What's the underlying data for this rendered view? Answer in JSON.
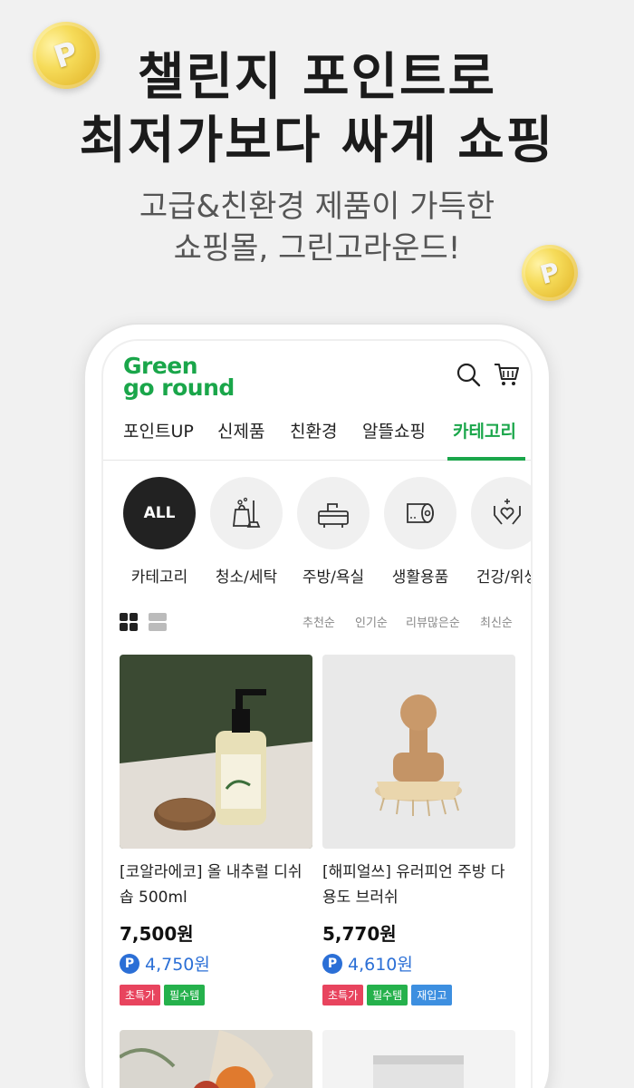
{
  "promo": {
    "headline_1": "챌린지 포인트로",
    "headline_2": "최저가보다 싸게 쇼핑",
    "subline_1": "고급&친환경 제품이 가득한",
    "subline_2": "쇼핑몰, 그린고라운드!",
    "coin_symbol": "P"
  },
  "app": {
    "logo_line_1": "Green",
    "logo_line_2": "go round",
    "brand_color": "#1aa64a",
    "tabs": [
      {
        "label": "포인트UP"
      },
      {
        "label": "신제품"
      },
      {
        "label": "친환경"
      },
      {
        "label": "알뜰쇼핑"
      },
      {
        "label": "카테고리",
        "active": true
      }
    ],
    "categories": [
      {
        "label": "카테고리",
        "circle": "ALL",
        "icon": "all-icon"
      },
      {
        "label": "청소/세탁",
        "icon": "cleaning-icon"
      },
      {
        "label": "주방/욕실",
        "icon": "kitchen-sink-icon"
      },
      {
        "label": "생활용품",
        "icon": "toilet-paper-icon"
      },
      {
        "label": "건강/위생",
        "icon": "health-hands-icon"
      }
    ],
    "sort_options": [
      "추천순",
      "인기순",
      "리뷰많은순",
      "최신순"
    ],
    "products": [
      {
        "name": "[코알라에코] 올 내추럴 디쉬솝 500ml",
        "price": "7,500원",
        "point_price": "4,750원",
        "tags": [
          {
            "label": "초특가",
            "color": "red"
          },
          {
            "label": "필수템",
            "color": "green"
          }
        ]
      },
      {
        "name": "[해피얼쓰] 유러피언 주방 다용도 브러쉬",
        "price": "5,770원",
        "point_price": "4,610원",
        "tags": [
          {
            "label": "초특가",
            "color": "red"
          },
          {
            "label": "필수템",
            "color": "green"
          },
          {
            "label": "재입고",
            "color": "blue"
          }
        ]
      }
    ],
    "point_symbol": "P"
  }
}
